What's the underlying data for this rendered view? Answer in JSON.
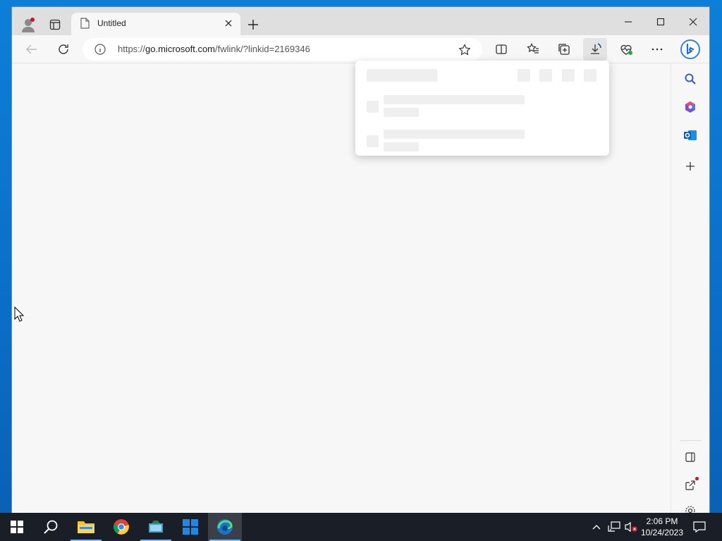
{
  "browser": {
    "tab": {
      "title": "Untitled"
    },
    "address": {
      "url_prefix": "https://",
      "url_host": "go.microsoft.com",
      "url_rest": "/fwlink/?linkid=2169346"
    }
  },
  "taskbar": {
    "time": "2:06 PM",
    "date": "10/24/2023"
  },
  "colors": {
    "edge_accent": "#0c59a4",
    "desktop": "#0a78d7",
    "taskbar": "#1a1e26"
  },
  "icons": {
    "toolbar": [
      "back-icon",
      "refresh-icon",
      "info-icon",
      "favorite-star-icon",
      "split-screen-icon",
      "favorites-icon",
      "collections-icon",
      "downloads-icon",
      "browser-essentials-icon",
      "more-icon",
      "bing-chat-icon"
    ],
    "sidebar": [
      "search-icon",
      "office-icon",
      "outlook-icon",
      "add-icon",
      "sidebar-toggle-icon",
      "external-link-icon",
      "settings-icon"
    ],
    "taskbar": [
      "start-icon",
      "search-icon",
      "file-explorer-icon",
      "chrome-icon",
      "app-icon",
      "windows-store-icon",
      "edge-icon"
    ]
  }
}
